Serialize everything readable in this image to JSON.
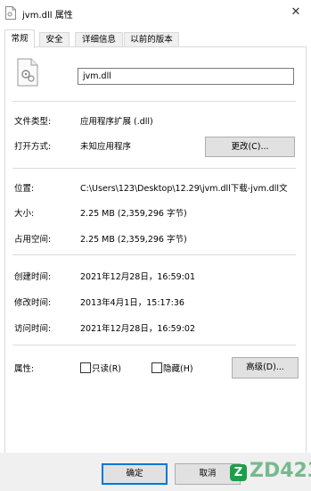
{
  "window": {
    "title": "jvm.dll 属性",
    "close_glyph": "✕"
  },
  "tabs": [
    {
      "label": "常规",
      "active": true
    },
    {
      "label": "安全",
      "active": false
    },
    {
      "label": "详细信息",
      "active": false
    },
    {
      "label": "以前的版本",
      "active": false
    }
  ],
  "file": {
    "name": "jvm.dll",
    "icon": "dll-file-icon"
  },
  "properties": {
    "type_label": "文件类型:",
    "type_value": "应用程序扩展 (.dll)",
    "opens_label": "打开方式:",
    "opens_value": "未知应用程序",
    "change_button": "更改(C)...",
    "location_label": "位置:",
    "location_value": "C:\\Users\\123\\Desktop\\12.29\\jvm.dll下载-jvm.dll文",
    "size_label": "大小:",
    "size_value": "2.25 MB (2,359,296 字节)",
    "disk_label": "占用空间:",
    "disk_value": "2.25 MB (2,359,296 字节)",
    "created_label": "创建时间:",
    "created_value": "2021年12月28日，16:59:01",
    "modified_label": "修改时间:",
    "modified_value": "2013年4月1日，15:17:36",
    "accessed_label": "访问时间:",
    "accessed_value": "2021年12月28日，16:59:02",
    "attributes_label": "属性:",
    "readonly_label": "只读(R)",
    "readonly_checked": false,
    "hidden_label": "隐藏(H)",
    "hidden_checked": false,
    "advanced_button": "高级(D)..."
  },
  "footer": {
    "ok_button": "确定",
    "cancel_button": "取消"
  },
  "watermark": {
    "badge": "Z",
    "text": "ZD423"
  },
  "colors": {
    "accent": "#0078d7",
    "button_bg": "#e1e1e1",
    "footer_bg": "#f0f0f0"
  }
}
